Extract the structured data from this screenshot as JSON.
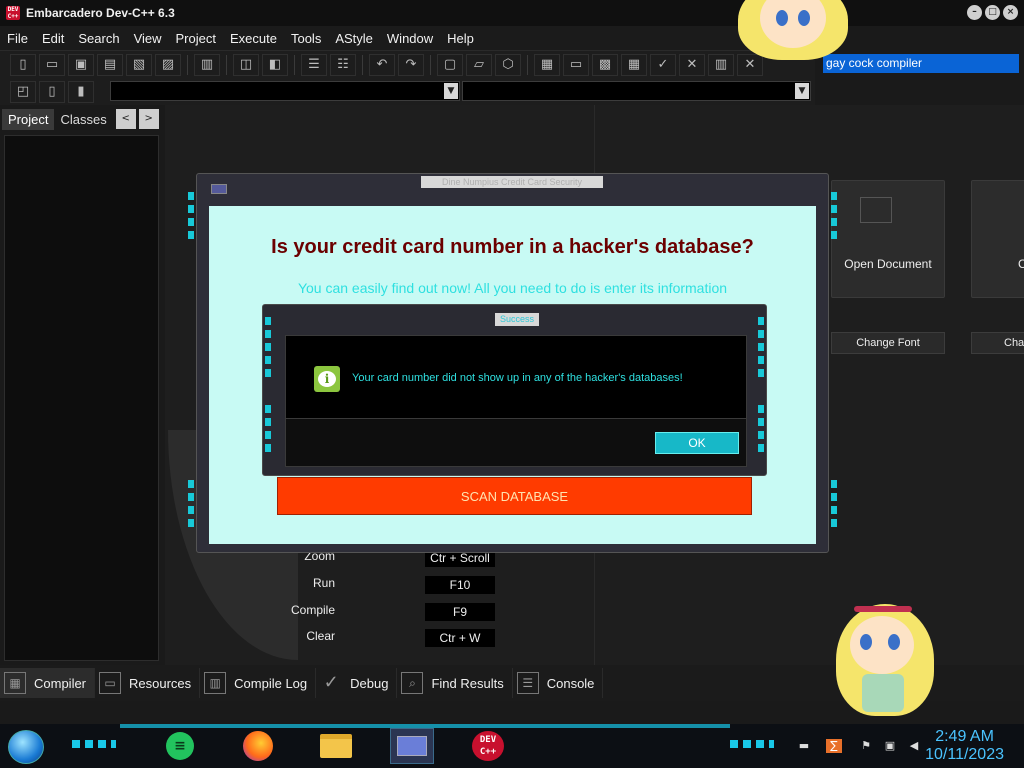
{
  "window": {
    "title": "Embarcadero Dev-C++ 6.3",
    "logo_text": "DEV C++",
    "controls": [
      "–",
      "□",
      "×"
    ]
  },
  "menu": [
    "File",
    "Edit",
    "Search",
    "View",
    "Project",
    "Execute",
    "Tools",
    "AStyle",
    "Window",
    "Help"
  ],
  "compiler_selector": {
    "value": "gay cock compiler"
  },
  "left_panel": {
    "tabs": [
      "Project",
      "Classes"
    ],
    "arrows": [
      "<",
      ">"
    ]
  },
  "welcome": {
    "tiles": [
      {
        "label": "Open Document"
      },
      {
        "label": "C"
      }
    ],
    "buttons": [
      "Change Font",
      "Cha"
    ],
    "shortcuts": [
      {
        "name": "Zoom",
        "key": "Ctr + Scroll"
      },
      {
        "name": "Run",
        "key": "F10"
      },
      {
        "name": "Compile",
        "key": "F9"
      },
      {
        "name": "Clear",
        "key": "Ctr + W"
      }
    ]
  },
  "scam_dialog": {
    "title": "Dine Numpius Credit Card Security",
    "headline": "Is your credit card number in a hacker's database?",
    "subline": "You can easily find out now! All you need to do is enter its information",
    "scan_button": "SCAN DATABASE"
  },
  "success_dialog": {
    "title": "Success",
    "message": "Your card number did not show up in any of the hacker's databases!",
    "ok_label": "OK",
    "icon": "info-icon"
  },
  "bottom_tabs": [
    "Compiler",
    "Resources",
    "Compile Log",
    "Debug",
    "Find Results",
    "Console"
  ],
  "taskbar": {
    "apps": [
      "notes-app",
      "firefox",
      "file-explorer",
      "active-window",
      "devcpp"
    ],
    "devcpp_label": "DEV C++",
    "clock_time": "2:49 AM",
    "clock_date": "10/11/2023"
  },
  "colors": {
    "accent_cyan": "#19c8e8",
    "scan_button": "#ff3b00",
    "headline": "#6b0000",
    "compiler_highlight": "#0a64d6"
  }
}
